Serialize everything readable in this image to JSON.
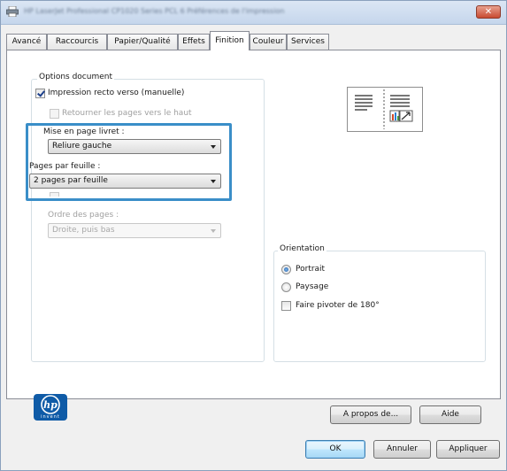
{
  "window": {
    "title": "HP LaserJet Professional CP1020 Series PCL 6 Préférences de l'impression",
    "close_label": "✕"
  },
  "tabs": [
    {
      "label": "Avancé"
    },
    {
      "label": "Raccourcis"
    },
    {
      "label": "Papier/Qualité"
    },
    {
      "label": "Effets"
    },
    {
      "label": "Finition",
      "active": true
    },
    {
      "label": "Couleur"
    },
    {
      "label": "Services"
    }
  ],
  "options_document": {
    "group_label": "Options document",
    "duplex_label": "Impression recto verso (manuelle)",
    "duplex_checked": true,
    "flip_label": "Retourner les pages vers le haut",
    "flip_checked": false,
    "booklet_label": "Mise en page livret :",
    "booklet_value": "Reliure gauche",
    "pps_label": "Pages par feuille :",
    "pps_value": "2 pages par feuille",
    "page_order_label": "Ordre des pages :",
    "page_order_value": "Droite, puis bas"
  },
  "orientation": {
    "group_label": "Orientation",
    "portrait_label": "Portrait",
    "portrait_checked": true,
    "landscape_label": "Paysage",
    "rotate_label": "Faire pivoter de 180°",
    "rotate_checked": false
  },
  "logo": {
    "text": "invent",
    "icon": "hp-logo-icon"
  },
  "buttons": {
    "about": "A propos de...",
    "help": "Aide",
    "ok": "OK",
    "cancel": "Annuler",
    "apply": "Appliquer"
  },
  "colors": {
    "highlight": "#3a8ec8",
    "hp_blue": "#0f5ba7"
  }
}
